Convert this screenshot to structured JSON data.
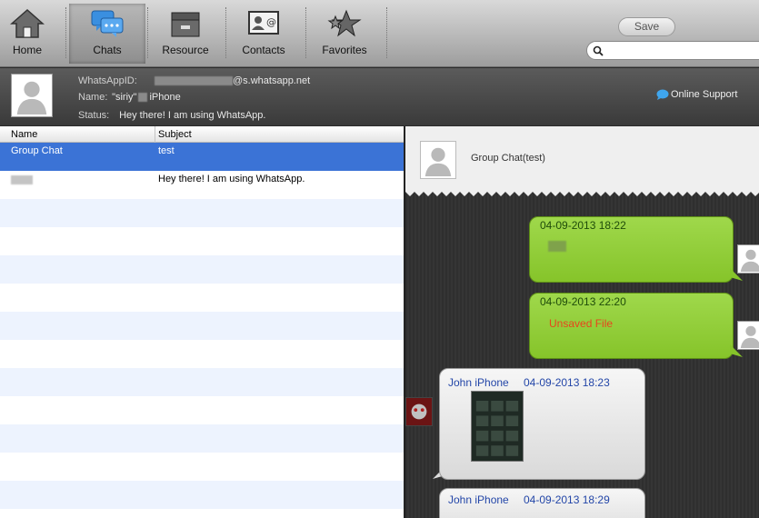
{
  "toolbar": {
    "items": [
      {
        "label": "Home",
        "icon": "home-icon"
      },
      {
        "label": "Chats",
        "icon": "chats-icon",
        "active": true
      },
      {
        "label": "Resource",
        "icon": "resource-icon"
      },
      {
        "label": "Contacts",
        "icon": "contacts-icon"
      },
      {
        "label": "Favorites",
        "icon": "favorites-icon"
      }
    ],
    "save_label": "Save",
    "search_placeholder": ""
  },
  "profile": {
    "whatsapp_label": "WhatsAppID:",
    "whatsapp_suffix": "@s.whatsapp.net",
    "name_label": "Name:",
    "name_quote": "\"siriy\"",
    "name_device": "iPhone",
    "status_label": "Status:",
    "status_value": "Hey there! I am using WhatsApp.",
    "support_label": "Online Support"
  },
  "list": {
    "columns": [
      "Name",
      "Subject"
    ],
    "rows": [
      {
        "name": "Group Chat",
        "subject": "test",
        "selected": true
      },
      {
        "name": "",
        "subject": "Hey there! I am using WhatsApp.",
        "selected": false
      }
    ]
  },
  "chat": {
    "title": "Group Chat(test)",
    "messages": [
      {
        "dir": "out",
        "time": "04-09-2013 18:22",
        "body": ""
      },
      {
        "dir": "out",
        "time": "04-09-2013 22:20",
        "body": "Unsaved File"
      },
      {
        "dir": "in",
        "sender": "John iPhone",
        "time": "04-09-2013 18:23",
        "body": ""
      },
      {
        "dir": "in",
        "sender": "John iPhone",
        "time": "04-09-2013 18:29",
        "body": ""
      }
    ]
  },
  "colors": {
    "selection": "#3b73d6",
    "outgoing_bubble": "#8fcc33",
    "incoming_text": "#2346a8",
    "unsaved_text": "#e8451c"
  }
}
